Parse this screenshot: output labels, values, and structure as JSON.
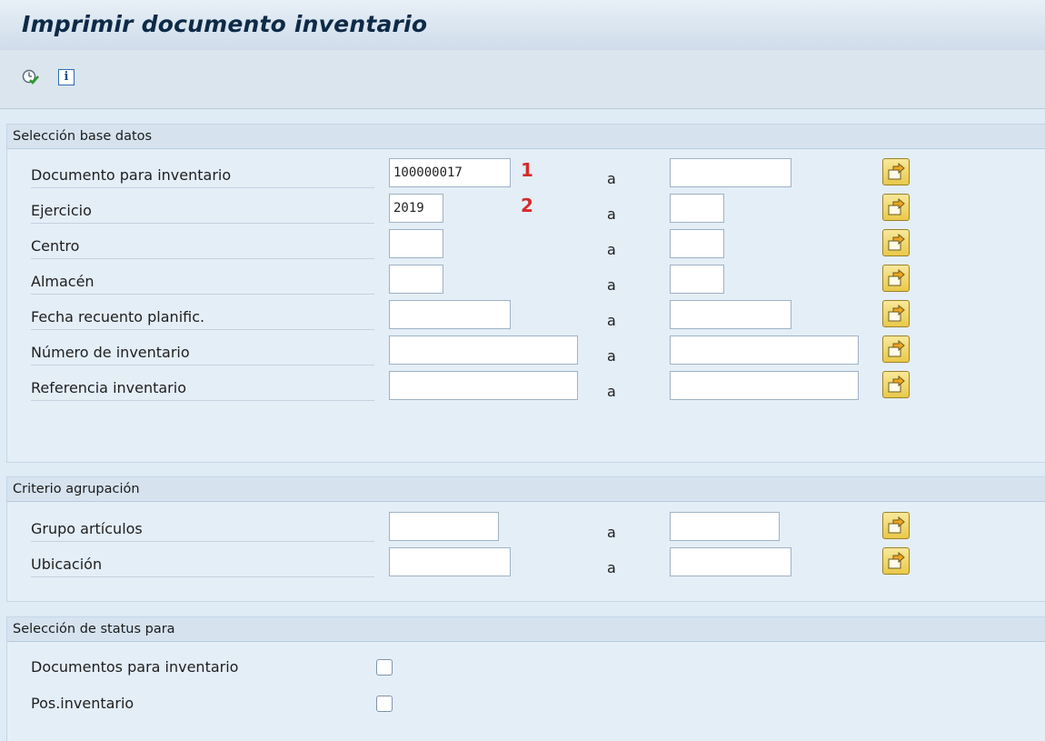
{
  "window": {
    "title": "Imprimir documento inventario"
  },
  "toolbar": {
    "execute_icon": "execute-clock-icon",
    "info_icon": "info-icon",
    "info_glyph": "i"
  },
  "range_word": "a",
  "sections": {
    "db_selection": {
      "title": "Selección base datos",
      "rows": [
        {
          "label": "Documento para inventario",
          "from": "100000017",
          "to": "",
          "marker": "1"
        },
        {
          "label": "Ejercicio",
          "from": "2019",
          "to": "",
          "marker": "2"
        },
        {
          "label": "Centro",
          "from": "",
          "to": ""
        },
        {
          "label": "Almacén",
          "from": "",
          "to": ""
        },
        {
          "label": "Fecha recuento planific.",
          "from": "",
          "to": ""
        },
        {
          "label": "Número de inventario",
          "from": "",
          "to": ""
        },
        {
          "label": "Referencia inventario",
          "from": "",
          "to": ""
        }
      ]
    },
    "grouping": {
      "title": "Criterio agrupación",
      "rows": [
        {
          "label": "Grupo artículos",
          "from": "",
          "to": ""
        },
        {
          "label": "Ubicación",
          "from": "",
          "to": ""
        }
      ]
    },
    "status": {
      "title": "Selección de status para",
      "checks": [
        {
          "label": "Documentos para inventario",
          "checked": false
        },
        {
          "label": "Pos.inventario",
          "checked": false
        }
      ]
    }
  },
  "colors": {
    "marker": "#d62b2b",
    "title": "#0d2a47",
    "button": "#e9c94a"
  }
}
